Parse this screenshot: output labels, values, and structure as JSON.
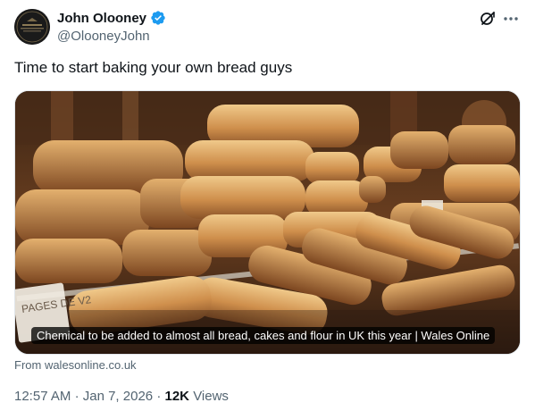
{
  "author": {
    "display_name": "John Olooney",
    "handle": "@OlooneyJohn",
    "verified": true
  },
  "icons": {
    "verified": "verified-badge-icon",
    "grok": "grok-icon",
    "more": "more-options-icon",
    "avatar": "profile-avatar"
  },
  "tweet": {
    "text": "Time to start baking your own bread guys"
  },
  "card": {
    "headline": "Chemical to be added to almost all bread, cakes and flour in UK this year | Wales Online",
    "source": "From walesonline.co.uk",
    "sign_text": "PAGES DE V2"
  },
  "meta": {
    "time": "12:57 AM",
    "separator": "·",
    "date": "Jan 7, 2026",
    "views_count": "12K",
    "views_label": "Views"
  },
  "colors": {
    "verified_blue": "#1d9bf0",
    "text_primary": "#0f1419",
    "text_secondary": "#536471"
  }
}
